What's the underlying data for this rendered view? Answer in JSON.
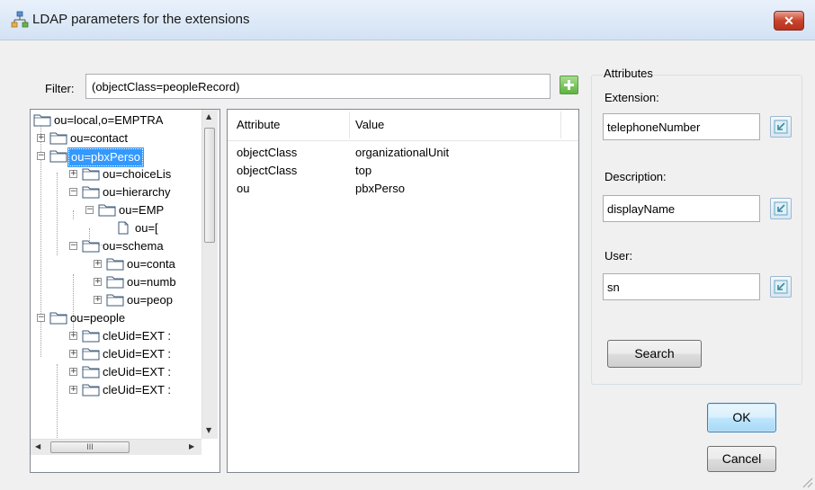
{
  "window": {
    "title": "LDAP parameters for the extensions",
    "close_glyph": "✕"
  },
  "filter": {
    "label": "Filter:",
    "value": "(objectClass=peopleRecord)"
  },
  "tree": {
    "nodes": [
      {
        "label": "ou=local,o=EMPTRA"
      },
      {
        "label": "ou=contact"
      },
      {
        "label": "ou=pbxPerso"
      },
      {
        "label": "ou=choiceLis"
      },
      {
        "label": "ou=hierarchy"
      },
      {
        "label": "ou=EMP"
      },
      {
        "label": "ou=["
      },
      {
        "label": "ou=schema"
      },
      {
        "label": "ou=conta"
      },
      {
        "label": "ou=numb"
      },
      {
        "label": "ou=peop"
      },
      {
        "label": "ou=people"
      },
      {
        "label": "cleUid=EXT :"
      },
      {
        "label": "cleUid=EXT :"
      },
      {
        "label": "cleUid=EXT :"
      },
      {
        "label": "cleUid=EXT :"
      }
    ],
    "hthumb_glyph": "III"
  },
  "attr_list": {
    "headers": [
      "Attribute",
      "Value"
    ],
    "rows": [
      {
        "attribute": "objectClass",
        "value": "organizationalUnit"
      },
      {
        "attribute": "objectClass",
        "value": "top"
      },
      {
        "attribute": "ou",
        "value": "pbxPerso"
      }
    ]
  },
  "attributes": {
    "legend": "Attributes",
    "extension": {
      "label": "Extension:",
      "value": "telephoneNumber"
    },
    "description": {
      "label": "Description:",
      "value": "displayName"
    },
    "user": {
      "label": "User:",
      "value": "sn"
    },
    "search_label": "Search"
  },
  "buttons": {
    "ok": "OK",
    "cancel": "Cancel"
  },
  "icons": {
    "app": "network-tree-icon",
    "folder": "folder-icon",
    "document": "document-icon",
    "add": "plus-icon",
    "pick": "pick-attribute-icon"
  },
  "colors": {
    "selection": "#3399ff",
    "close": "#c9442c",
    "add": "#5fb241"
  }
}
